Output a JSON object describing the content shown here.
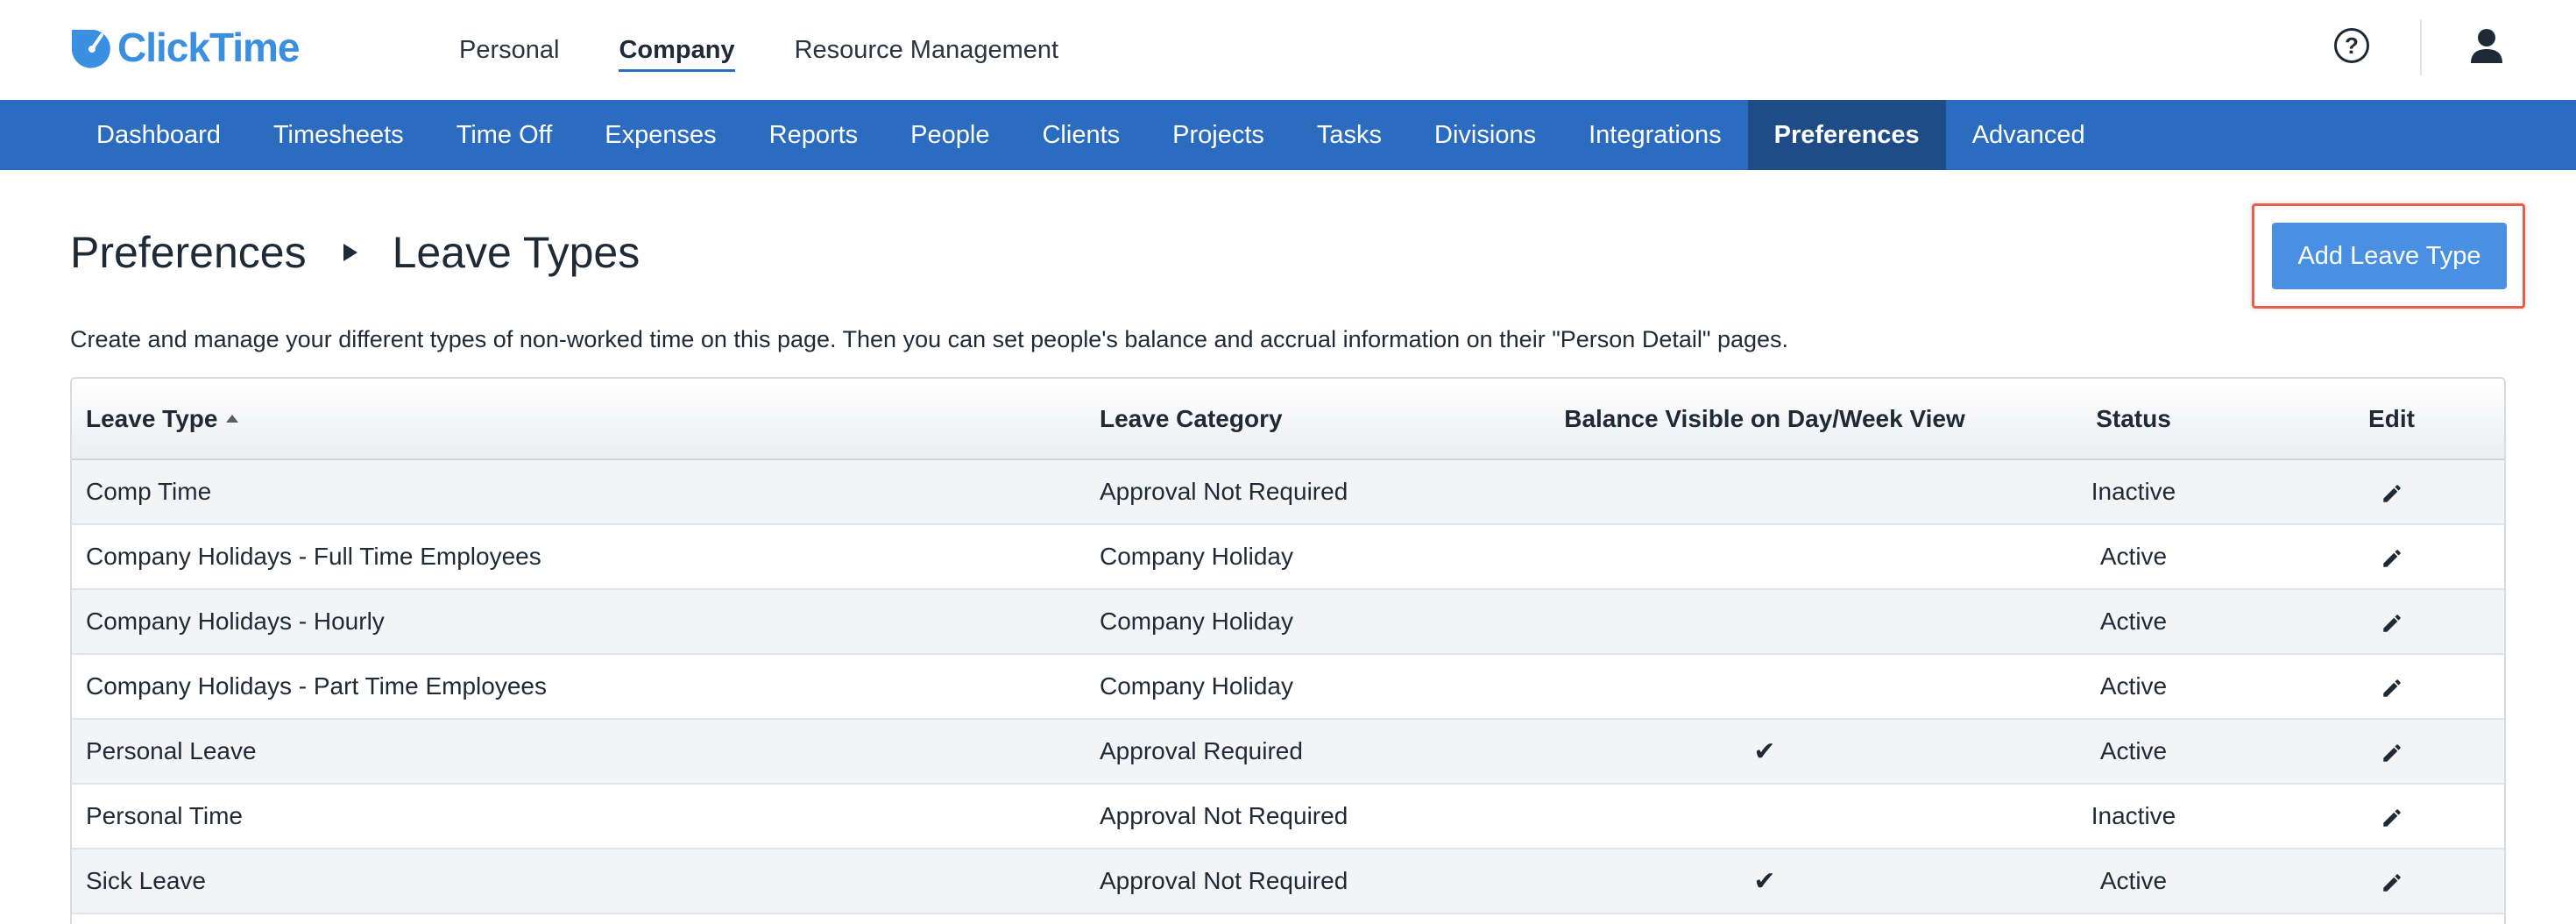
{
  "app": {
    "logo_text": "ClickTime"
  },
  "topnav": {
    "items": [
      {
        "label": "Personal",
        "active": false
      },
      {
        "label": "Company",
        "active": true
      },
      {
        "label": "Resource Management",
        "active": false
      }
    ]
  },
  "topbar": {
    "help_icon": "question-circle-icon",
    "help_glyph": "?",
    "user_icon": "user-icon"
  },
  "subnav": {
    "items": [
      {
        "label": "Dashboard",
        "active": false
      },
      {
        "label": "Timesheets",
        "active": false
      },
      {
        "label": "Time Off",
        "active": false
      },
      {
        "label": "Expenses",
        "active": false
      },
      {
        "label": "Reports",
        "active": false
      },
      {
        "label": "People",
        "active": false
      },
      {
        "label": "Clients",
        "active": false
      },
      {
        "label": "Projects",
        "active": false
      },
      {
        "label": "Tasks",
        "active": false
      },
      {
        "label": "Divisions",
        "active": false
      },
      {
        "label": "Integrations",
        "active": false
      },
      {
        "label": "Preferences",
        "active": true
      },
      {
        "label": "Advanced",
        "active": false
      }
    ]
  },
  "page": {
    "breadcrumb": [
      "Preferences",
      "Leave Types"
    ],
    "add_button_label": "Add Leave Type",
    "description": "Create and manage your different types of non-worked time on this page. Then you can set people's balance and accrual information on their \"Person Detail\" pages."
  },
  "table": {
    "columns": [
      "Leave Type",
      "Leave Category",
      "Balance Visible on Day/Week View",
      "Status",
      "Edit"
    ],
    "sorted_column": "Leave Type",
    "sort_direction": "ascending",
    "check_glyph": "✔",
    "rows": [
      {
        "leave_type": "Comp Time",
        "category": "Approval Not Required",
        "balance_visible": false,
        "status": "Inactive"
      },
      {
        "leave_type": "Company Holidays - Full Time Employees",
        "category": "Company Holiday",
        "balance_visible": false,
        "status": "Active"
      },
      {
        "leave_type": "Company Holidays - Hourly",
        "category": "Company Holiday",
        "balance_visible": false,
        "status": "Active"
      },
      {
        "leave_type": "Company Holidays - Part Time Employees",
        "category": "Company Holiday",
        "balance_visible": false,
        "status": "Active"
      },
      {
        "leave_type": "Personal Leave",
        "category": "Approval Required",
        "balance_visible": true,
        "status": "Active"
      },
      {
        "leave_type": "Personal Time",
        "category": "Approval Not Required",
        "balance_visible": false,
        "status": "Inactive"
      },
      {
        "leave_type": "Sick Leave",
        "category": "Approval Not Required",
        "balance_visible": true,
        "status": "Active"
      }
    ]
  },
  "colors": {
    "brand": "#3b8fe0",
    "subnav_bg": "#2b6cc0",
    "subnav_active_bg": "#1d4c87",
    "button_bg": "#4a90e2",
    "highlight_outline": "#e0634d"
  }
}
